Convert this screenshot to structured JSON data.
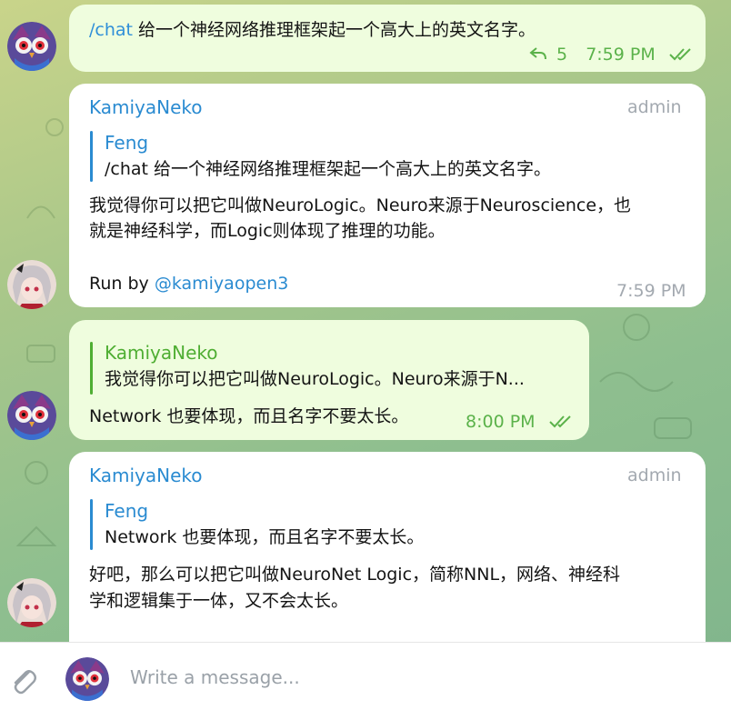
{
  "composer": {
    "placeholder": "Write a message..."
  },
  "messages": [
    {
      "command": "/chat",
      "text": " 给一个神经网络推理框架起一个高大上的英文名字。",
      "replies": "5",
      "time": "7:59 PM"
    },
    {
      "sender": "KamiyaNeko",
      "badge": "admin",
      "quote_name": "Feng",
      "quote_text": "/chat 给一个神经网络推理框架起一个高大上的英文名字。",
      "body_line1": "我觉得你可以把它叫做NeuroLogic。Neuro来源于Neuroscience，也",
      "body_line2": "就是神经科学，而Logic则体现了推理的功能。",
      "footer_prefix": "Run by ",
      "footer_link": "@kamiyaopen3",
      "time": "7:59 PM"
    },
    {
      "quote_name": "KamiyaNeko",
      "quote_text": "我觉得你可以把它叫做NeuroLogic。Neuro来源于N...",
      "text": "Network  也要体现，而且名字不要太长。",
      "time": "8:00 PM"
    },
    {
      "sender": "KamiyaNeko",
      "badge": "admin",
      "quote_name": "Feng",
      "quote_text": "Network  也要体现，而且名字不要太长。",
      "body_line1": "好吧，那么可以把它叫做NeuroNet Logic，简称NNL，网络、神经科",
      "body_line2": "学和逻辑集于一体，又不会太长。"
    }
  ]
}
